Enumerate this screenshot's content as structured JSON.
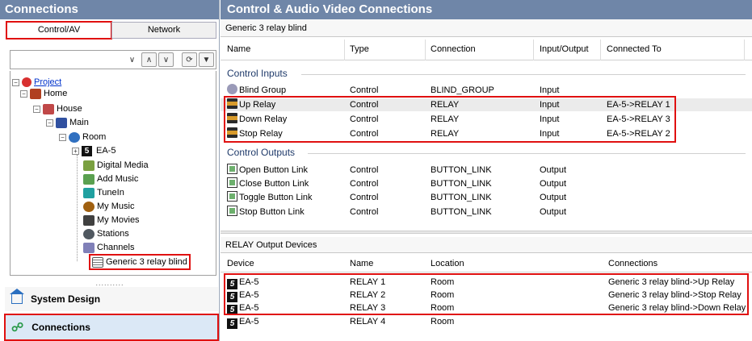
{
  "left": {
    "title": "Connections",
    "tabs": [
      "Control/AV",
      "Network"
    ],
    "tree": {
      "project": "Project",
      "home": "Home",
      "house": "House",
      "main": "Main",
      "room": "Room",
      "ea5": "EA-5",
      "items": [
        "Digital Media",
        "Add Music",
        "TuneIn",
        "My Music",
        "My Movies",
        "Stations",
        "Channels",
        "Generic 3 relay blind"
      ]
    },
    "dots": "..........",
    "nav": {
      "system_design": "System Design",
      "connections": "Connections"
    }
  },
  "right": {
    "title": "Control & Audio Video Connections",
    "device_name": "Generic 3 relay blind",
    "columns": [
      "Name",
      "Type",
      "Connection",
      "Input/Output",
      "Connected To"
    ],
    "control_inputs_label": "Control Inputs",
    "control_inputs": [
      {
        "name": "Blind Group",
        "type": "Control",
        "connection": "BLIND_GROUP",
        "io": "Input",
        "to": ""
      },
      {
        "name": "Up Relay",
        "type": "Control",
        "connection": "RELAY",
        "io": "Input",
        "to": "EA-5->RELAY 1"
      },
      {
        "name": "Down Relay",
        "type": "Control",
        "connection": "RELAY",
        "io": "Input",
        "to": "EA-5->RELAY 3"
      },
      {
        "name": "Stop Relay",
        "type": "Control",
        "connection": "RELAY",
        "io": "Input",
        "to": "EA-5->RELAY 2"
      }
    ],
    "control_outputs_label": "Control Outputs",
    "control_outputs": [
      {
        "name": "Open Button Link",
        "type": "Control",
        "connection": "BUTTON_LINK",
        "io": "Output"
      },
      {
        "name": "Close Button Link",
        "type": "Control",
        "connection": "BUTTON_LINK",
        "io": "Output"
      },
      {
        "name": "Toggle Button Link",
        "type": "Control",
        "connection": "BUTTON_LINK",
        "io": "Output"
      },
      {
        "name": "Stop Button Link",
        "type": "Control",
        "connection": "BUTTON_LINK",
        "io": "Output"
      }
    ],
    "relay_title": "RELAY Output Devices",
    "relay_columns": [
      "Device",
      "Name",
      "Location",
      "Connections"
    ],
    "relay_rows": [
      {
        "device": "EA-5",
        "name": "RELAY 1",
        "location": "Room",
        "connections": "Generic 3 relay blind->Up Relay"
      },
      {
        "device": "EA-5",
        "name": "RELAY 2",
        "location": "Room",
        "connections": "Generic 3 relay blind->Stop Relay"
      },
      {
        "device": "EA-5",
        "name": "RELAY 3",
        "location": "Room",
        "connections": "Generic 3 relay blind->Down Relay"
      },
      {
        "device": "EA-5",
        "name": "RELAY 4",
        "location": "Room",
        "connections": ""
      }
    ]
  },
  "colors": {
    "header_bg": "#6f86a8",
    "highlight": "#e01010",
    "group_text": "#1f3a6a"
  }
}
